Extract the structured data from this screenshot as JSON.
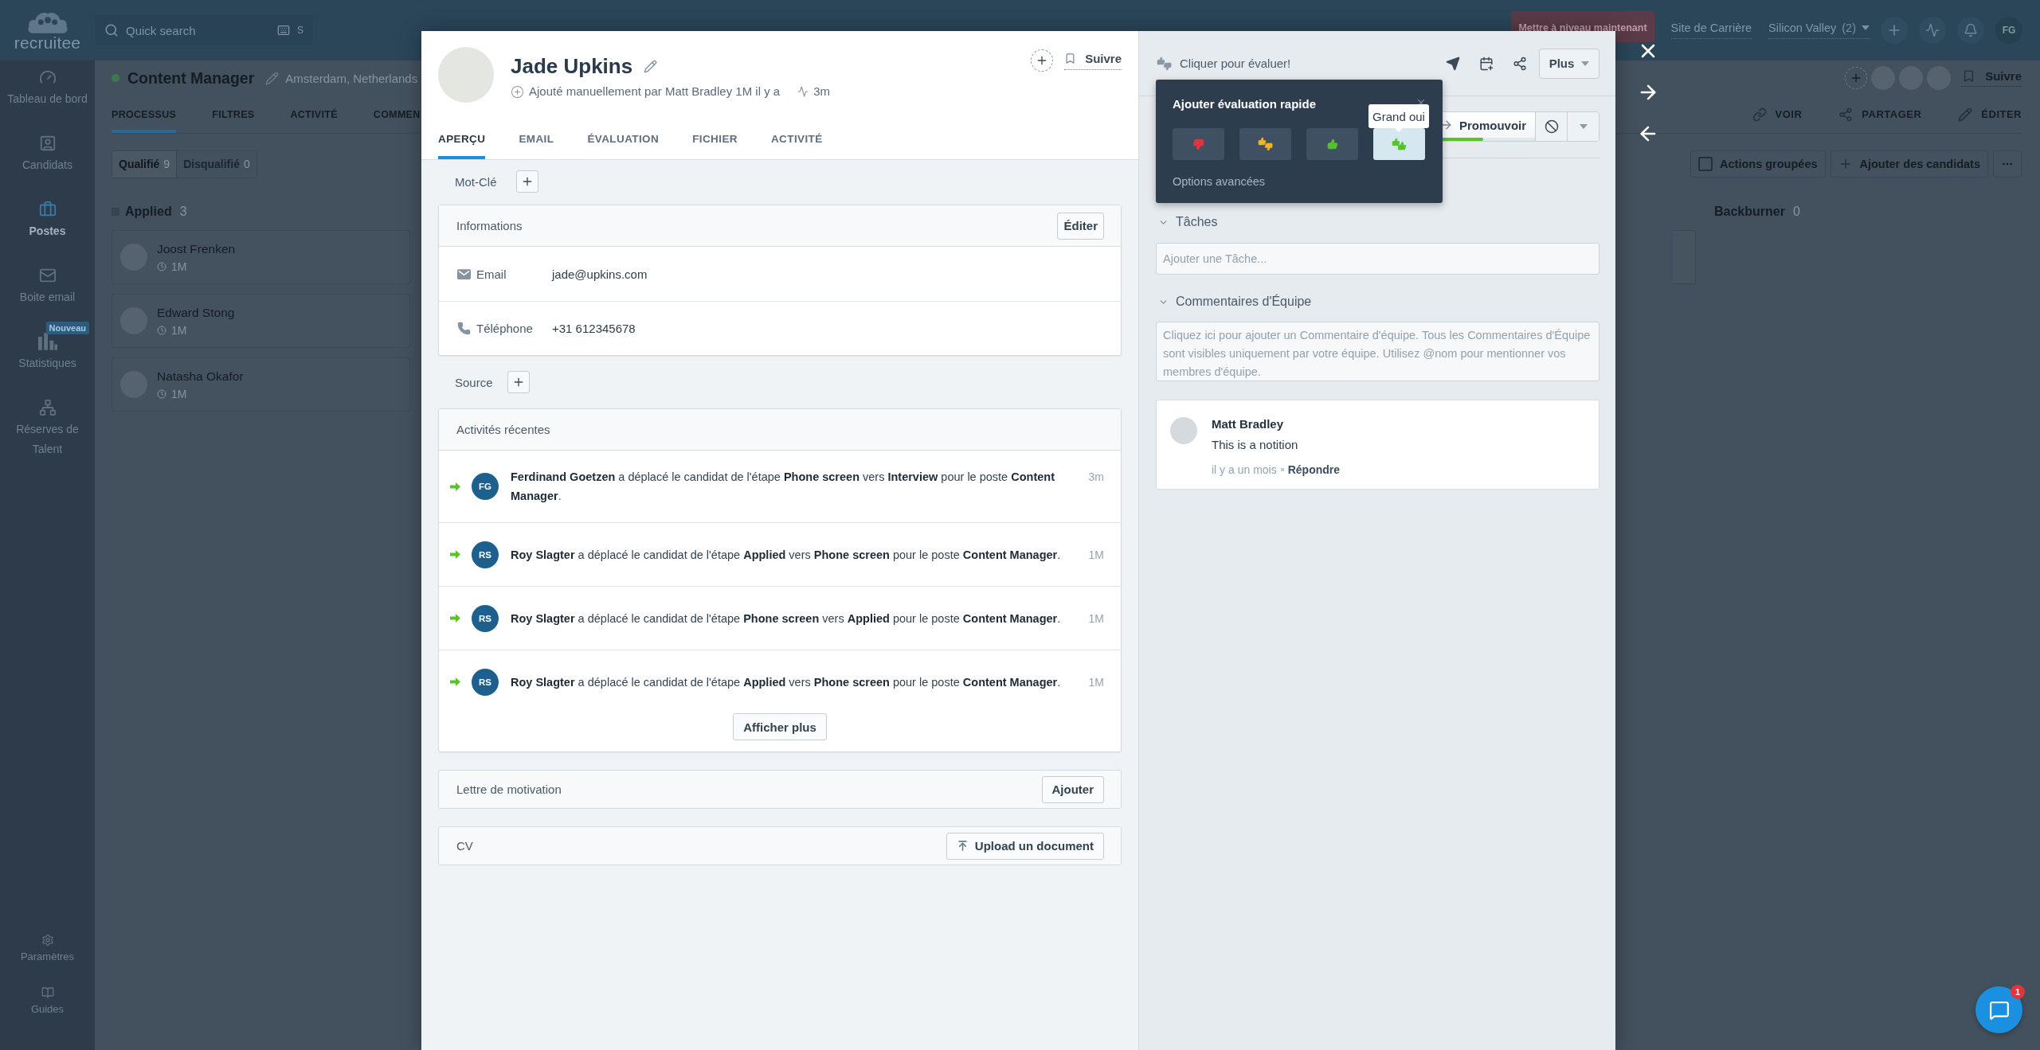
{
  "app": {
    "logo": "recruitee",
    "search": {
      "placeholder": "Quick search",
      "shortcut": "S"
    },
    "upgrade": "Mettre à niveau maintenant",
    "career_site": "Site de Carrière",
    "company": {
      "name": "Silicon Valley",
      "count": "(2)"
    },
    "user_initials": "FG"
  },
  "sidebar": {
    "items": [
      {
        "label": "Tableau de bord",
        "selected": false
      },
      {
        "label": "Candidats",
        "selected": false
      },
      {
        "label": "Postes",
        "selected": true
      },
      {
        "label": "Boite email",
        "selected": false
      },
      {
        "label": "Statistiques",
        "selected": false,
        "badge": "Nouveau"
      },
      {
        "label": "Réserves de Talent",
        "selected": false
      }
    ],
    "bottom_items": [
      {
        "label": "Paramètres"
      },
      {
        "label": "Guides"
      }
    ]
  },
  "job": {
    "title": "Content Manager",
    "location": "Amsterdam, Netherlands",
    "follow": "Suivre",
    "tabs": [
      {
        "label": "PROCESSUS",
        "selected": true
      },
      {
        "label": "FILTRES",
        "selected": false
      },
      {
        "label": "ACTIVITÉ",
        "selected": false
      },
      {
        "label": "COMMEN",
        "selected": false
      }
    ],
    "actions": [
      {
        "label": "VOIR"
      },
      {
        "label": "PARTAGER"
      },
      {
        "label": "ÉDITER"
      }
    ],
    "filters": [
      {
        "label": "Qualifié",
        "count": "9",
        "selected": true
      },
      {
        "label": "Disqualifié",
        "count": "0",
        "selected": false
      }
    ],
    "bulk_actions": {
      "label": "Actions groupées",
      "checked": false
    },
    "add_candidates": "Ajouter des candidats",
    "stages": [
      {
        "name": "Applied",
        "count": "3",
        "candidates": [
          {
            "name": "Joost Frenken",
            "time": "1M"
          },
          {
            "name": "Edward Stong",
            "time": "1M"
          },
          {
            "name": "Natasha Okafor",
            "time": "1M"
          }
        ]
      },
      {
        "name": "Backburner",
        "count": "0"
      }
    ]
  },
  "candidate": {
    "name": "Jade Upkins",
    "added": "Ajouté manuellement par Matt Bradley 1M il y a",
    "last_activity": "3m",
    "follow": "Suivre",
    "tabs": [
      {
        "label": "APERÇU",
        "selected": true
      },
      {
        "label": "EMAIL",
        "selected": false
      },
      {
        "label": "ÉVALUATION",
        "selected": false
      },
      {
        "label": "FICHIER",
        "selected": false
      },
      {
        "label": "ACTIVITÉ",
        "selected": false
      }
    ],
    "tags_label": "Mot-Clé",
    "info": {
      "title": "Informations",
      "edit": "Éditer",
      "fields": [
        {
          "label": "Email",
          "value": "jade@upkins.com"
        },
        {
          "label": "Téléphone",
          "value": "+31 612345678"
        }
      ]
    },
    "source_label": "Source",
    "activities": {
      "title": "Activités récentes",
      "items": [
        {
          "initials": "FG",
          "text": "**Ferdinand Goetzen** a déplacé le candidat de l'étape **Phone screen** vers **Interview** pour le poste **Content Manager**.",
          "time": "3m"
        },
        {
          "initials": "RS",
          "text": "**Roy Slagter** a déplacé le candidat de l'étape **Applied** vers **Phone screen** pour le poste **Content Manager**.",
          "time": "1M"
        },
        {
          "initials": "RS",
          "text": "**Roy Slagter** a déplacé le candidat de l'étape **Phone screen** vers **Applied** pour le poste **Content Manager**.",
          "time": "1M"
        },
        {
          "initials": "RS",
          "text": "**Roy Slagter** a déplacé le candidat de l'étape **Applied** vers **Phone screen** pour le poste **Content Manager**.",
          "time": "1M"
        }
      ],
      "more": "Afficher plus"
    },
    "cover_letter": {
      "title": "Lettre de motivation",
      "button": "Ajouter"
    },
    "cv": {
      "title": "CV",
      "button": "Upload un document"
    }
  },
  "evaluation": {
    "prompt": "Cliquer pour évaluer!",
    "more": "Plus",
    "promote": {
      "label": "Promouvoir",
      "level": 0.5
    },
    "quick_rating": {
      "title": "Ajouter évaluation rapide",
      "options": [
        {
          "kind": "no",
          "selected": false
        },
        {
          "kind": "mixed",
          "selected": false
        },
        {
          "kind": "yes",
          "selected": false
        },
        {
          "kind": "strong_yes",
          "selected": true
        }
      ],
      "tooltip": "Grand oui",
      "advanced": "Options avancées"
    },
    "tasks": {
      "title": "Tâches",
      "expanded": true,
      "placeholder": "Ajouter une Tâche..."
    },
    "comments": {
      "title": "Commentaires d'Équipe",
      "expanded": true,
      "placeholder": "Cliquez ici pour ajouter un Commentaire d'équipe. Tous les Commentaires d'Équipe sont visibles uniquement par votre équipe. Utilisez @nom pour mentionner vos membres d'équipe.",
      "items": [
        {
          "author": "Matt Bradley",
          "text": "This is a notition",
          "time": "il y a un mois",
          "reply": "Répondre"
        }
      ]
    }
  },
  "chat": {
    "badge": "1"
  }
}
